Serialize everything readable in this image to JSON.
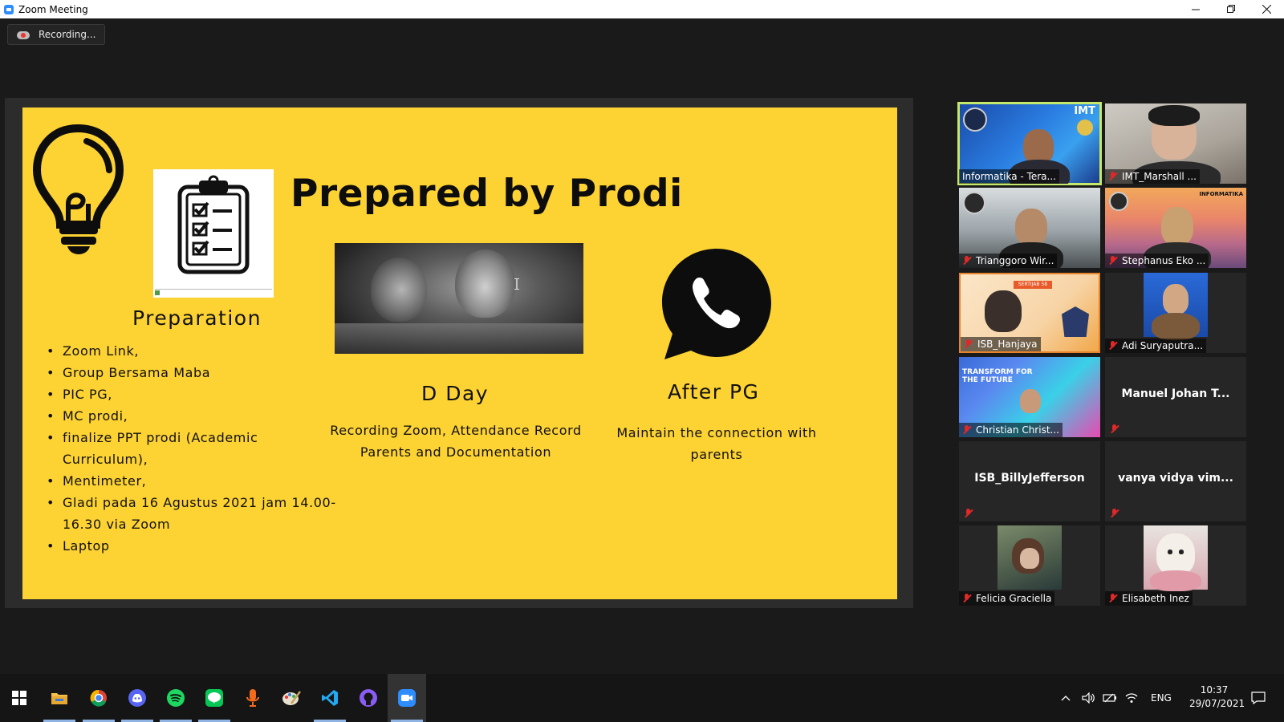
{
  "window": {
    "title": "Zoom Meeting",
    "controls": [
      "minimize-icon",
      "restore-icon",
      "close-icon"
    ]
  },
  "recording": {
    "label": "Recording...",
    "icon": "cloud-record-icon"
  },
  "slide": {
    "background": "#fdd233",
    "title": "Prepared by Prodi",
    "sections": {
      "preparation": {
        "heading": "Preparation",
        "items": [
          "Zoom Link,",
          "Group Bersama Maba",
          "PIC PG,",
          "MC prodi,",
          "finalize PPT prodi (Academic Curriculum),",
          "Mentimeter,",
          "Gladi pada 16 Agustus 2021 jam 14.00-16.30 via Zoom",
          "Laptop"
        ]
      },
      "dday": {
        "heading": "D Day",
        "desc_line1": "Recording Zoom, Attendance Record",
        "desc_line2": "Parents and Documentation"
      },
      "after": {
        "heading": "After PG",
        "desc_line1": "Maintain the connection with",
        "desc_line2": "parents"
      }
    },
    "icons": [
      "lightbulb-icon",
      "clipboard-checklist-icon",
      "whatsapp-icon"
    ]
  },
  "participants": [
    {
      "name": "Informatika - Tera...",
      "muted": false,
      "video": true,
      "active_speaker": true,
      "overlay_text": "IMT"
    },
    {
      "name": "IMT_Marshall ...",
      "muted": true,
      "video": true
    },
    {
      "name": "Trianggoro Wir...",
      "muted": true,
      "video": true
    },
    {
      "name": "Stephanus Eko ...",
      "muted": true,
      "video": true,
      "overlay_text": "INFORMATIKA"
    },
    {
      "name": "ISB_Hanjaya",
      "muted": true,
      "video": true,
      "overlay_text": "SERTIJAB 58"
    },
    {
      "name": "Adi Suryaputra...",
      "muted": true,
      "video": false,
      "has_photo": true
    },
    {
      "name": "Christian Christ...",
      "muted": true,
      "video": true,
      "overlay_text": "TRANSFORM FOR THE FUTURE"
    },
    {
      "name": "Manuel Johan T...",
      "muted": true,
      "video": false
    },
    {
      "name": "ISB_BillyJefferson",
      "muted": true,
      "video": false
    },
    {
      "name": "vanya vidya vim...",
      "muted": true,
      "video": false
    },
    {
      "name": "Felicia Graciella",
      "muted": true,
      "video": false,
      "has_photo": true
    },
    {
      "name": "Elisabeth Inez",
      "muted": true,
      "video": false,
      "has_photo": true
    }
  ],
  "taskbar": {
    "apps": [
      "windows-start-icon",
      "file-explorer-icon",
      "chrome-icon",
      "discord-icon",
      "spotify-icon",
      "line-icon",
      "podcast-mic-icon",
      "paint-icon",
      "vscode-icon",
      "github-icon",
      "zoom-icon"
    ],
    "tray": {
      "language": "ENG",
      "time": "10:37",
      "date": "29/07/2021"
    }
  }
}
